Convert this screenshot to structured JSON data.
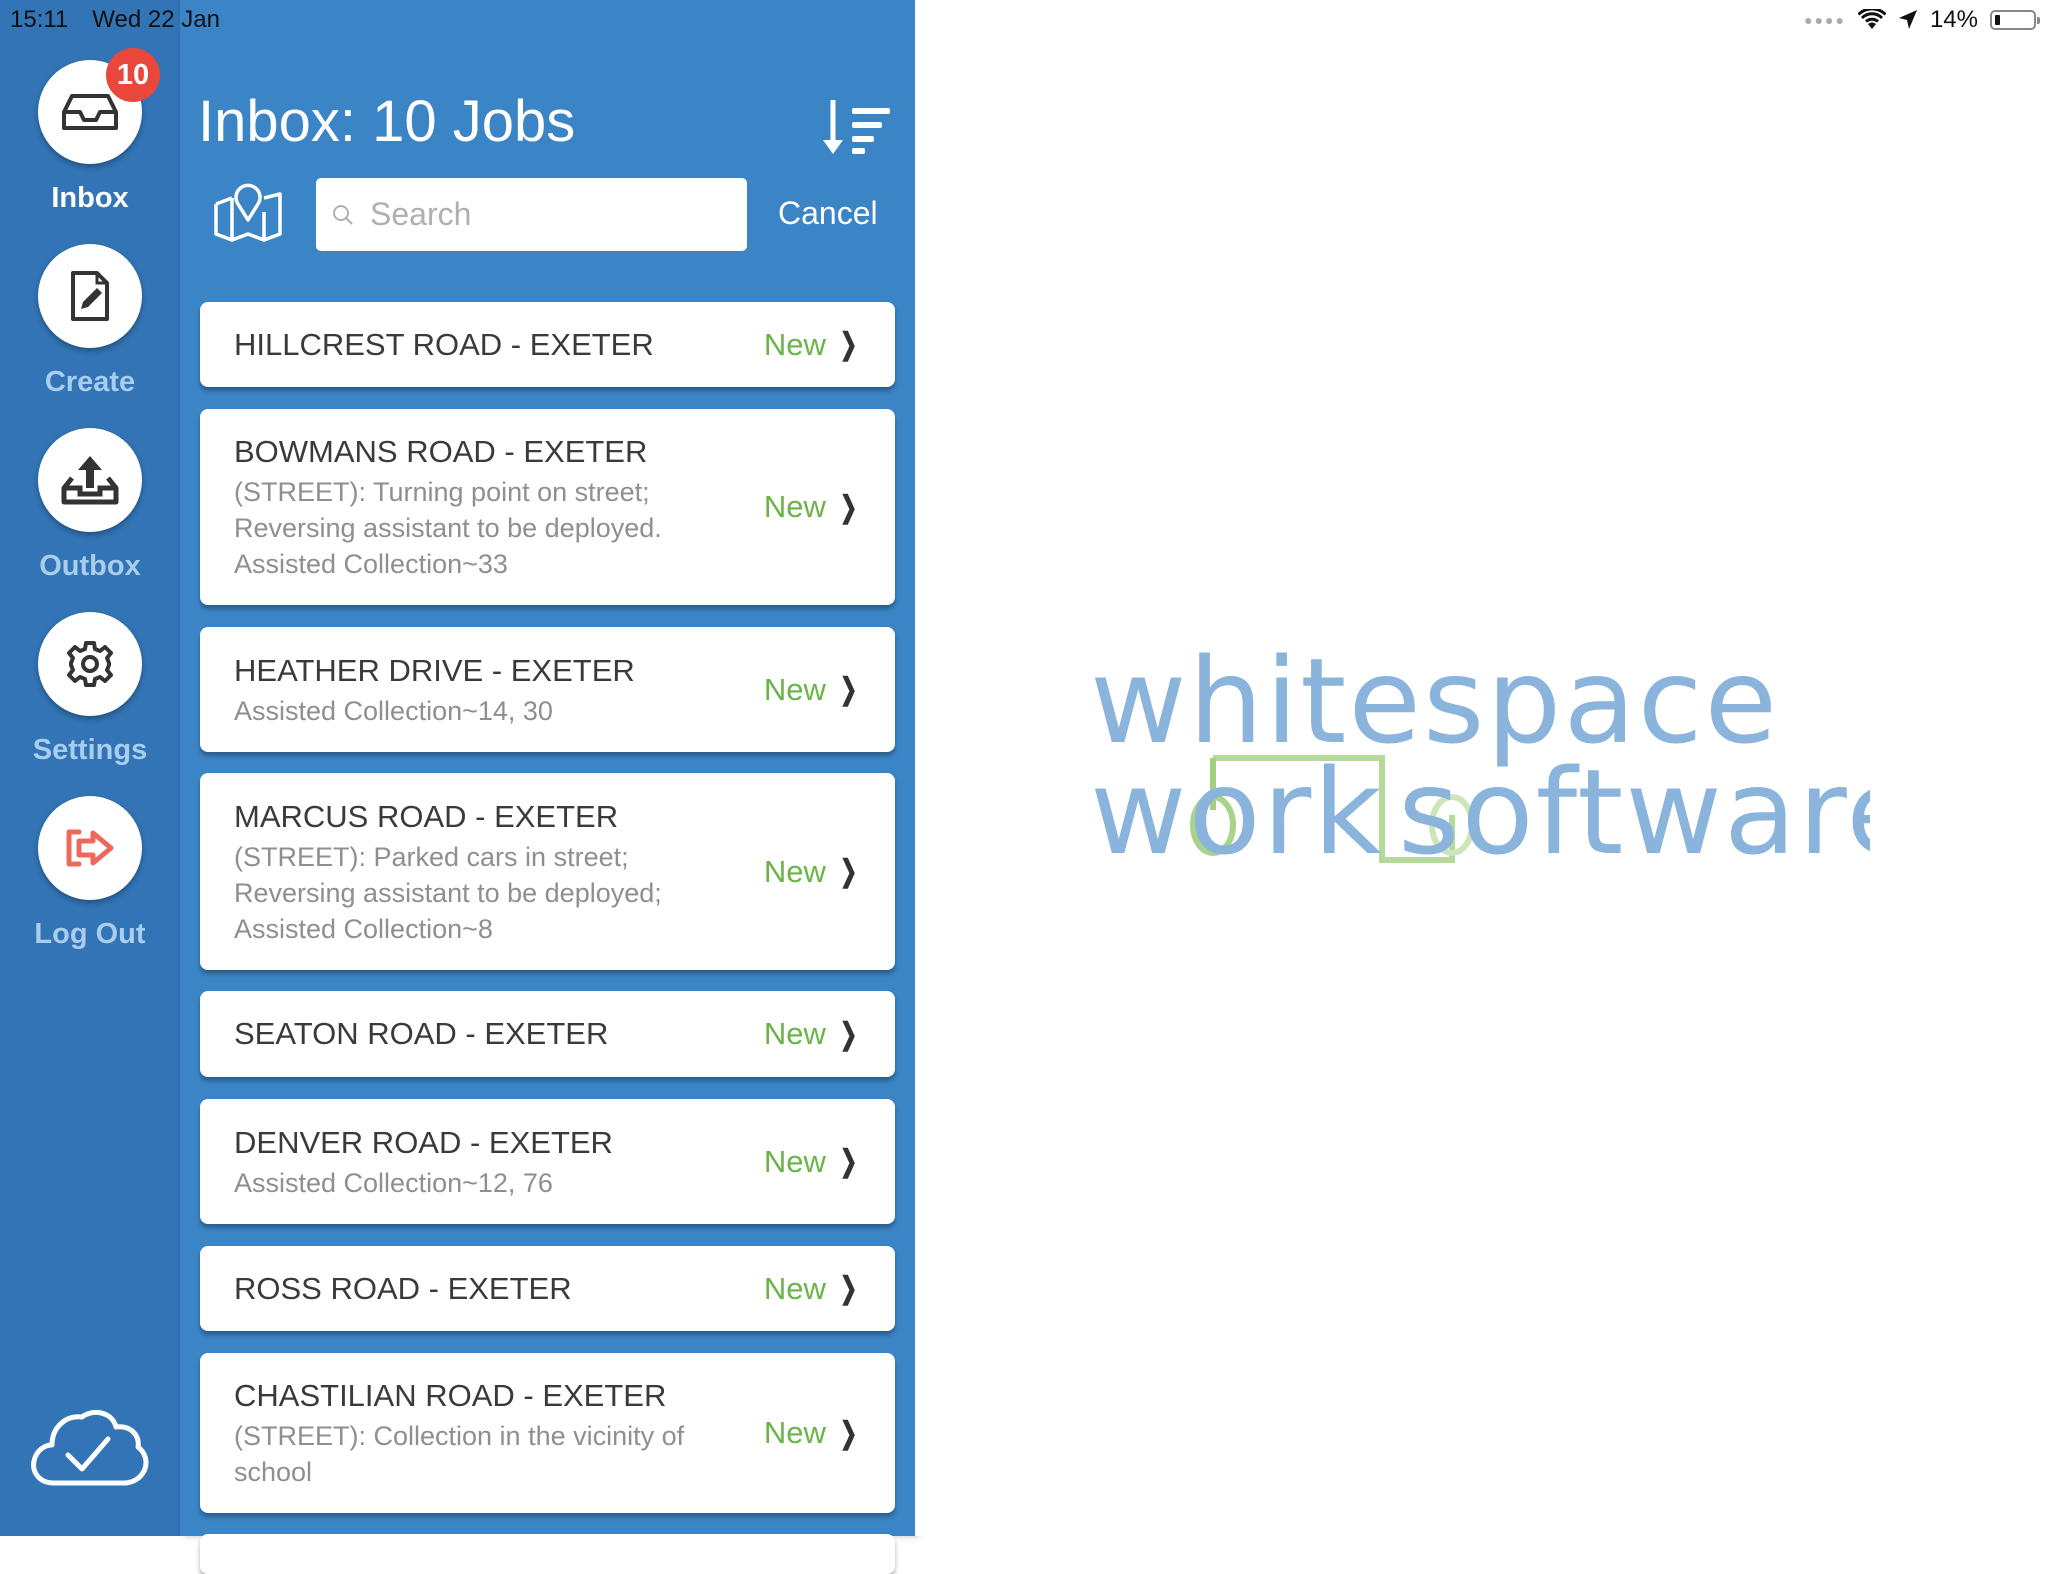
{
  "status_bar": {
    "time": "15:11",
    "date": "Wed 22 Jan",
    "battery_percent": "14%",
    "battery_level": 0.14,
    "icons": [
      "signal-dots-icon",
      "wifi-icon",
      "location-arrow-icon",
      "battery-icon"
    ]
  },
  "sidebar": {
    "items": [
      {
        "label": "Inbox",
        "icon": "inbox-tray-icon",
        "badge": "10",
        "active": true
      },
      {
        "label": "Create",
        "icon": "document-edit-icon",
        "active": false
      },
      {
        "label": "Outbox",
        "icon": "outbox-upload-icon",
        "active": false
      },
      {
        "label": "Settings",
        "icon": "gear-icon",
        "active": false
      },
      {
        "label": "Log Out",
        "icon": "logout-arrow-icon",
        "active": false
      }
    ],
    "sync_icon": "cloud-check-icon"
  },
  "list": {
    "title": "Inbox: 10 Jobs",
    "sort_icon": "sort-descending-icon",
    "map_icon": "map-pin-icon",
    "search": {
      "placeholder": "Search",
      "value": ""
    },
    "cancel_label": "Cancel",
    "jobs": [
      {
        "title": "HILLCREST ROAD - EXETER",
        "description": "",
        "status": "New"
      },
      {
        "title": "BOWMANS ROAD - EXETER",
        "description": "(STREET): Turning point on street; Reversing assistant to be deployed. Assisted Collection~33",
        "status": "New"
      },
      {
        "title": "HEATHER DRIVE - EXETER",
        "description": "Assisted Collection~14, 30",
        "status": "New"
      },
      {
        "title": "MARCUS ROAD - EXETER",
        "description": "(STREET): Parked cars in street; Reversing assistant to be deployed; Assisted Collection~8",
        "status": "New"
      },
      {
        "title": "SEATON ROAD - EXETER",
        "description": "",
        "status": "New"
      },
      {
        "title": "DENVER ROAD - EXETER",
        "description": "Assisted Collection~12, 76",
        "status": "New"
      },
      {
        "title": "ROSS ROAD - EXETER",
        "description": "",
        "status": "New"
      },
      {
        "title": "CHASTILIAN ROAD - EXETER",
        "description": "(STREET): Collection in the vicinity of school",
        "status": "New"
      }
    ]
  },
  "detail": {
    "logo_line1": "whitespace",
    "logo_line2a": "work",
    "logo_line2b": "software"
  },
  "colors": {
    "sidebar_bg": "#3274b5",
    "list_bg": "#3b85c7",
    "status_new": "#6bb447",
    "badge": "#e9473b",
    "logout_icon": "#ec6a5c",
    "logo_blue": "#8ab4dc",
    "logo_green": "#a9d38a"
  }
}
